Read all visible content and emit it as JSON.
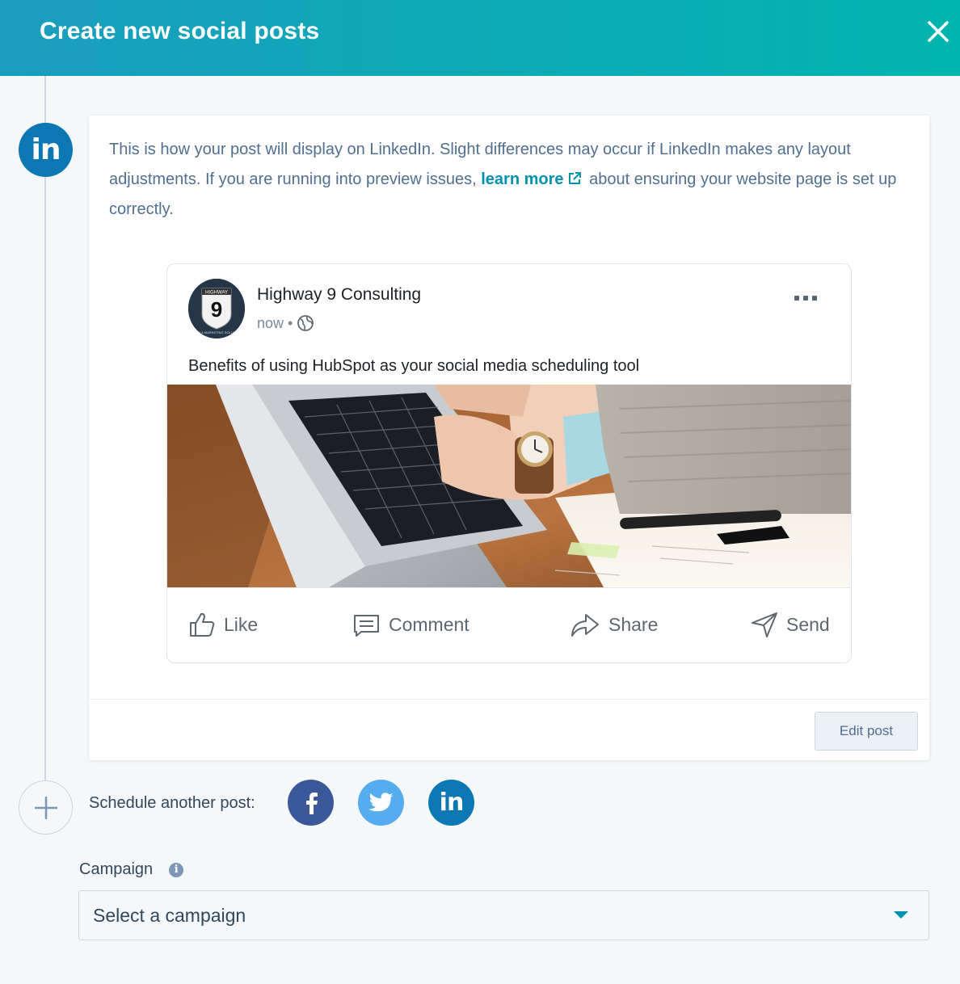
{
  "header": {
    "title": "Create new social posts",
    "close_icon": "close-icon"
  },
  "network": {
    "badge_text": "in",
    "name": "LinkedIn",
    "color": "#0b78b4"
  },
  "card": {
    "info_before_link": "This is how your post will display on LinkedIn. Slight differences may occur if LinkedIn makes any layout adjustments. If you are running into preview issues,",
    "info_link": "learn more",
    "info_after_link": "about ensuring your website page is set up correctly.",
    "edit_button": "Edit post"
  },
  "preview": {
    "page_name": "Highway 9 Consulting",
    "avatar_text": "9",
    "avatar_top_text": "HIGHWAY",
    "avatar_bottom_text": "SALES & MARKETING SOLUTIONS",
    "time": "now",
    "separator": "•",
    "post_text": "Benefits of using HubSpot as your social media scheduling tool",
    "actions": [
      {
        "label": "Like",
        "icon": "thumbs-up-icon"
      },
      {
        "label": "Comment",
        "icon": "comment-icon"
      },
      {
        "label": "Share",
        "icon": "share-arrow-icon"
      },
      {
        "label": "Send",
        "icon": "send-icon"
      }
    ]
  },
  "schedule": {
    "label": "Schedule another post:",
    "networks": [
      {
        "name": "facebook",
        "text": "f",
        "color": "#3b5998"
      },
      {
        "name": "twitter",
        "color": "#55acee"
      },
      {
        "name": "linkedin",
        "text": "in",
        "color": "#0b78b4"
      }
    ]
  },
  "campaign": {
    "label": "Campaign",
    "info_icon": "i",
    "placeholder": "Select a campaign"
  },
  "colors": {
    "header_start": "#1a9ebd",
    "header_end": "#00b5b0",
    "link": "#0091ae"
  }
}
